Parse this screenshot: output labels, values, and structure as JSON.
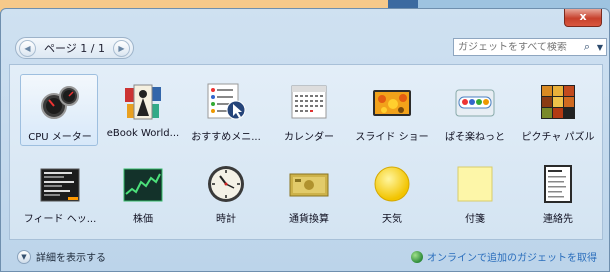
{
  "window": {
    "close_label": "x"
  },
  "pager": {
    "label": "ページ 1 / 1",
    "prev": "◀",
    "next": "▶"
  },
  "search": {
    "placeholder": "ガジェットをすべて検索",
    "icon": "search-icon"
  },
  "gadgets": [
    {
      "label": "CPU メーター",
      "icon": "cpu-meter-icon"
    },
    {
      "label": "eBook World...",
      "icon": "ebook-world-icon"
    },
    {
      "label": "おすすめメニ...",
      "icon": "recommend-menu-icon"
    },
    {
      "label": "カレンダー",
      "icon": "calendar-icon"
    },
    {
      "label": "スライド ショー",
      "icon": "slideshow-icon"
    },
    {
      "label": "ぱそ楽ねっと",
      "icon": "pasoraku-icon"
    },
    {
      "label": "ピクチャ パズル",
      "icon": "picture-puzzle-icon"
    },
    {
      "label": "フィード ヘッ...",
      "icon": "feed-headlines-icon"
    },
    {
      "label": "株価",
      "icon": "stocks-icon"
    },
    {
      "label": "時計",
      "icon": "clock-icon"
    },
    {
      "label": "通貨換算",
      "icon": "currency-icon"
    },
    {
      "label": "天気",
      "icon": "weather-icon"
    },
    {
      "label": "付箋",
      "icon": "sticky-note-icon"
    },
    {
      "label": "連絡先",
      "icon": "contacts-icon"
    }
  ],
  "footer": {
    "details_label": "詳細を表示する",
    "online_label": "オンラインで追加のガジェットを取得"
  },
  "colors": {
    "link": "#2a6ebc",
    "close": "#c7412c"
  }
}
